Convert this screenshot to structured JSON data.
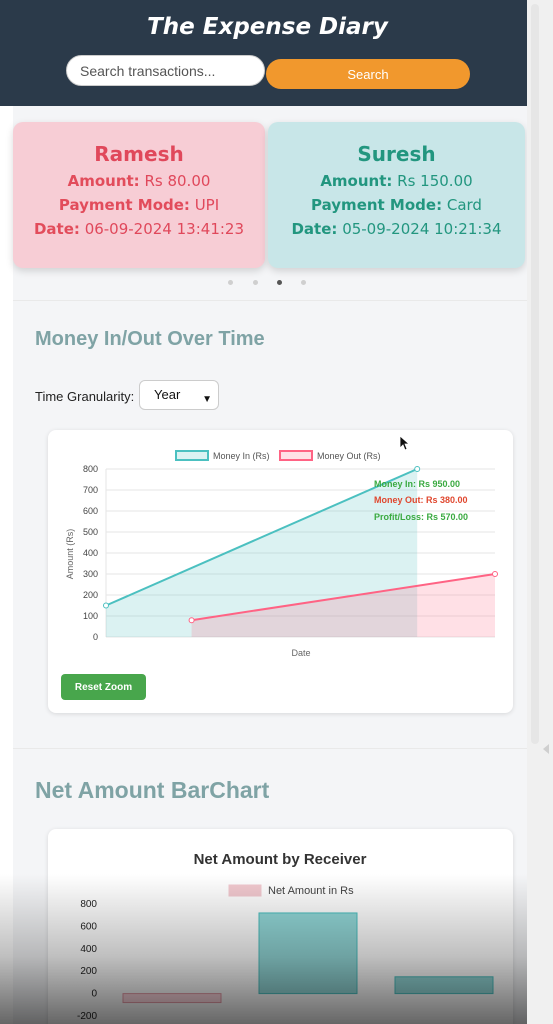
{
  "header": {
    "title": "The Expense Diary",
    "search_placeholder": "Search transactions...",
    "search_button": "Search"
  },
  "carousel": {
    "cards": [
      {
        "name": "Ramesh",
        "amount_label": "Amount:",
        "amount": "Rs 80.00",
        "mode_label": "Payment Mode:",
        "mode": "UPI",
        "date_label": "Date:",
        "date": "06-09-2024 13:41:23",
        "color": "#f7cdd5"
      },
      {
        "name": "Suresh",
        "amount_label": "Amount:",
        "amount": "Rs 150.00",
        "mode_label": "Payment Mode:",
        "mode": "Card",
        "date_label": "Date:",
        "date": "05-09-2024 10:21:34",
        "color": "#c8e6e8"
      }
    ],
    "dots": 4,
    "active_dot": 2
  },
  "money_section": {
    "title": "Money In/Out Over Time",
    "granularity_label": "Time Granularity:",
    "granularity_value": "Year",
    "reset_zoom": "Reset Zoom",
    "tooltip": {
      "money_in": "Money In: Rs 950.00",
      "money_out": "Money Out: Rs 380.00",
      "profit_loss": "Profit/Loss: Rs 570.00"
    }
  },
  "bar_section": {
    "title": "Net Amount BarChart"
  },
  "chart_data": [
    {
      "type": "line",
      "title": "",
      "xlabel": "Date",
      "ylabel": "Amount (Rs)",
      "ylim": [
        0,
        800
      ],
      "yticks": [
        0,
        100,
        200,
        300,
        400,
        500,
        600,
        700,
        800
      ],
      "grid": true,
      "legend": "top",
      "series": [
        {
          "name": "Money In (Rs)",
          "color": "#4bc0c0",
          "points": [
            [
              0,
              150
            ],
            [
              0.8,
              800
            ]
          ]
        },
        {
          "name": "Money Out (Rs)",
          "color": "#ff6384",
          "points": [
            [
              0.22,
              80
            ],
            [
              1.0,
              300
            ]
          ]
        }
      ]
    },
    {
      "type": "bar",
      "title": "Net Amount by Receiver",
      "ylabel": "",
      "ylim": [
        -200,
        800
      ],
      "yticks": [
        800,
        600,
        400,
        200,
        0,
        -200
      ],
      "legend": "top",
      "series": [
        {
          "name": "Net Amount in Rs",
          "color": "#4bc0c0",
          "values": [
            -80,
            720,
            150
          ]
        }
      ]
    }
  ]
}
